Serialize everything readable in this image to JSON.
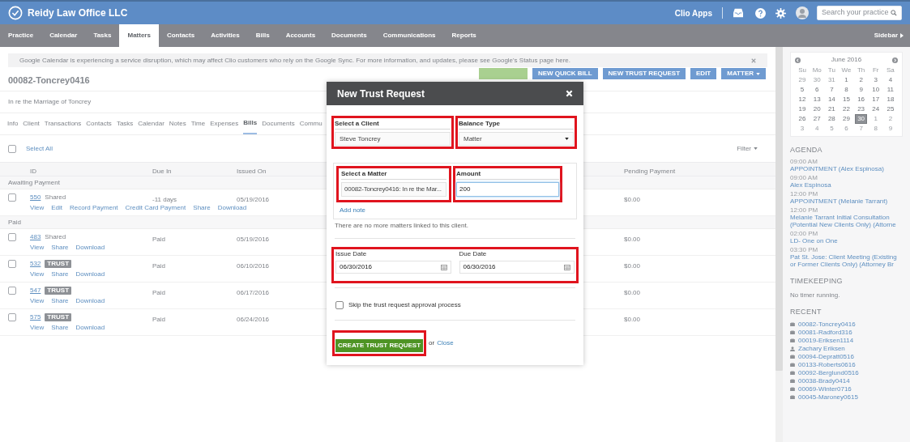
{
  "app_bar": {
    "title": "Reidy Law Office LLC",
    "apps_link": "Clio Apps",
    "search": {
      "placeholder": "Search your practice"
    }
  },
  "nav": {
    "tabs": [
      {
        "label": "Practice",
        "selected": false
      },
      {
        "label": "Calendar",
        "selected": false
      },
      {
        "label": "Tasks",
        "selected": false
      },
      {
        "label": "Matters",
        "selected": true
      },
      {
        "label": "Contacts",
        "selected": false
      },
      {
        "label": "Activities",
        "selected": false
      },
      {
        "label": "Bills",
        "selected": false
      },
      {
        "label": "Accounts",
        "selected": false
      },
      {
        "label": "Documents",
        "selected": false
      },
      {
        "label": "Communications",
        "selected": false
      },
      {
        "label": "Reports",
        "selected": false
      }
    ],
    "sidebar_toggle": "Sidebar"
  },
  "banner": {
    "text": "Google Calendar is experiencing a service disruption, which may affect Clio customers who rely on the Google Sync. For more information, and updates, please see Google's Status page here."
  },
  "matter": {
    "title": "00082-Toncrey0416",
    "description": "In re the Marriage of Toncrey",
    "actions": [
      {
        "kind": "success"
      },
      {
        "kind": "default",
        "label": "NEW QUICK BILL"
      },
      {
        "kind": "default",
        "label": "NEW TRUST REQUEST"
      },
      {
        "kind": "default",
        "label": "EDIT"
      },
      {
        "kind": "menu",
        "label": "MATTER"
      }
    ]
  },
  "tabs": [
    {
      "label": "Info",
      "selected": false
    },
    {
      "label": "Client",
      "selected": false
    },
    {
      "label": "Transactions",
      "selected": false
    },
    {
      "label": "Contacts",
      "selected": false
    },
    {
      "label": "Tasks",
      "selected": false
    },
    {
      "label": "Calendar",
      "selected": false
    },
    {
      "label": "Notes",
      "selected": false
    },
    {
      "label": "Time",
      "selected": false
    },
    {
      "label": "Expenses",
      "selected": false
    },
    {
      "label": "Bills",
      "selected": true
    },
    {
      "label": "Documents",
      "selected": false
    },
    {
      "label": "Commu",
      "selected": false
    }
  ],
  "bills": {
    "select_all": {
      "label": "Select All",
      "checked": false
    },
    "filter": "Filter",
    "columns": [
      "ID",
      "Due In",
      "Issued On",
      "Pending Payment"
    ],
    "groups": [
      {
        "name": "Awaiting Payment",
        "rows": [
          {
            "id": "550",
            "tag": {
              "kind": "shared",
              "text": "Shared"
            },
            "checked": false,
            "due_in": "-11 days",
            "issued_on": "05/19/2016",
            "pending_payment": "$0.00",
            "actions": [
              "View",
              "Edit",
              "Record Payment",
              "Credit Card Payment",
              "Share",
              "Download"
            ]
          }
        ]
      },
      {
        "name": "Paid",
        "rows": [
          {
            "id": "483",
            "tag": {
              "kind": "shared",
              "text": "Shared"
            },
            "checked": false,
            "due_in": "Paid",
            "issued_on": "05/19/2016",
            "pending_payment": "$0.00",
            "actions": [
              "View",
              "Share",
              "Download"
            ]
          },
          {
            "id": "532",
            "tag": {
              "kind": "badge",
              "text": "TRUST"
            },
            "checked": false,
            "due_in": "Paid",
            "issued_on": "06/10/2016",
            "pending_payment": "$0.00",
            "actions": [
              "View",
              "Share",
              "Download"
            ]
          },
          {
            "id": "547",
            "tag": {
              "kind": "badge",
              "text": "TRUST"
            },
            "checked": false,
            "due_in": "Paid",
            "issued_on": "06/17/2016",
            "pending_payment": "$0.00",
            "actions": [
              "View",
              "Share",
              "Download"
            ]
          },
          {
            "id": "575",
            "tag": {
              "kind": "badge",
              "text": "TRUST"
            },
            "checked": false,
            "due_in": "Paid",
            "issued_on": "06/24/2016",
            "pending_payment": "$0.00",
            "actions": [
              "View",
              "Share",
              "Download"
            ]
          }
        ]
      }
    ]
  },
  "modal": {
    "title": "New Trust Request",
    "client": {
      "label": "Select a Client",
      "value": "Steve Toncrey"
    },
    "balance_type": {
      "label": "Balance Type",
      "value": "Matter"
    },
    "matter": {
      "label": "Select a Matter",
      "value": "00082-Toncrey0416: In re the Mar..."
    },
    "amount": {
      "label": "Amount",
      "value": "200",
      "focused": true
    },
    "add_note": "Add note",
    "note": "There are no more matters linked to this client.",
    "issue_date": {
      "label": "Issue Date",
      "value": "06/30/2016"
    },
    "due_date": {
      "label": "Due Date",
      "value": "06/30/2016"
    },
    "skip_approval": {
      "label": "Skip the trust request approval process",
      "checked": false
    },
    "submit": "CREATE TRUST REQUEST",
    "close_prefix": "or",
    "close_link": "Close"
  },
  "sidebar": {
    "calendar": {
      "month": "June 2016",
      "weekdays": [
        "Su",
        "Mo",
        "Tu",
        "We",
        "Th",
        "Fr",
        "Sa"
      ],
      "weeks": [
        [
          {
            "d": "29",
            "other_month": true,
            "selected": false
          },
          {
            "d": "30",
            "other_month": true,
            "selected": false
          },
          {
            "d": "31",
            "other_month": true,
            "selected": false
          },
          {
            "d": "1",
            "other_month": false,
            "selected": false
          },
          {
            "d": "2",
            "other_month": false,
            "selected": false
          },
          {
            "d": "3",
            "other_month": false,
            "selected": false
          },
          {
            "d": "4",
            "other_month": false,
            "selected": false
          }
        ],
        [
          {
            "d": "5",
            "other_month": false,
            "selected": false
          },
          {
            "d": "6",
            "other_month": false,
            "selected": false
          },
          {
            "d": "7",
            "other_month": false,
            "selected": false
          },
          {
            "d": "8",
            "other_month": false,
            "selected": false
          },
          {
            "d": "9",
            "other_month": false,
            "selected": false
          },
          {
            "d": "10",
            "other_month": false,
            "selected": false
          },
          {
            "d": "11",
            "other_month": false,
            "selected": false
          }
        ],
        [
          {
            "d": "12",
            "other_month": false,
            "selected": false
          },
          {
            "d": "13",
            "other_month": false,
            "selected": false
          },
          {
            "d": "14",
            "other_month": false,
            "selected": false
          },
          {
            "d": "15",
            "other_month": false,
            "selected": false
          },
          {
            "d": "16",
            "other_month": false,
            "selected": false
          },
          {
            "d": "17",
            "other_month": false,
            "selected": false
          },
          {
            "d": "18",
            "other_month": false,
            "selected": false
          }
        ],
        [
          {
            "d": "19",
            "other_month": false,
            "selected": false
          },
          {
            "d": "20",
            "other_month": false,
            "selected": false
          },
          {
            "d": "21",
            "other_month": false,
            "selected": false
          },
          {
            "d": "22",
            "other_month": false,
            "selected": false
          },
          {
            "d": "23",
            "other_month": false,
            "selected": false
          },
          {
            "d": "24",
            "other_month": false,
            "selected": false
          },
          {
            "d": "25",
            "other_month": false,
            "selected": false
          }
        ],
        [
          {
            "d": "26",
            "other_month": false,
            "selected": false
          },
          {
            "d": "27",
            "other_month": false,
            "selected": false
          },
          {
            "d": "28",
            "other_month": false,
            "selected": false
          },
          {
            "d": "29",
            "other_month": false,
            "selected": false
          },
          {
            "d": "30",
            "other_month": false,
            "selected": true
          },
          {
            "d": "1",
            "other_month": true,
            "selected": false
          },
          {
            "d": "2",
            "other_month": true,
            "selected": false
          }
        ],
        [
          {
            "d": "3",
            "other_month": true,
            "selected": false
          },
          {
            "d": "4",
            "other_month": true,
            "selected": false
          },
          {
            "d": "5",
            "other_month": true,
            "selected": false
          },
          {
            "d": "6",
            "other_month": true,
            "selected": false
          },
          {
            "d": "7",
            "other_month": true,
            "selected": false
          },
          {
            "d": "8",
            "other_month": true,
            "selected": false
          },
          {
            "d": "9",
            "other_month": true,
            "selected": false
          }
        ]
      ]
    },
    "agenda": {
      "title": "AGENDA",
      "items": [
        {
          "time": "09:00 AM",
          "title": "APPOINTMENT (Alex Espinosa)"
        },
        {
          "time": "09:00 AM",
          "title": "Alex Espinosa"
        },
        {
          "time": "12:00 PM",
          "title": "APPOINTMENT (Melanie Tarrant)"
        },
        {
          "time": "12:00 PM",
          "title": "Melanie Tarrant Initial Consultation (Potential New Clients Only) (Attorne"
        },
        {
          "time": "02:00 PM",
          "title": "LD- One on One"
        },
        {
          "time": "03:30 PM",
          "title": "Pat St. Jose: Client Meeting (Existing or Former Clients Only) (Attorney Br"
        }
      ]
    },
    "timekeeping": {
      "title": "TIMEKEEPING",
      "status": "No timer running."
    },
    "recent": {
      "title": "RECENT",
      "items": [
        {
          "kind": "matter",
          "label": "00082-Toncrey0416"
        },
        {
          "kind": "matter",
          "label": "00081-Radford316"
        },
        {
          "kind": "matter",
          "label": "00019-Eriksen1114"
        },
        {
          "kind": "contact",
          "label": "Zachary Eriksen"
        },
        {
          "kind": "matter",
          "label": "00094-Depratt0516"
        },
        {
          "kind": "matter",
          "label": "00133-Roberts0616"
        },
        {
          "kind": "matter",
          "label": "00092-Berglund0516"
        },
        {
          "kind": "matter",
          "label": "00038-Brady0414"
        },
        {
          "kind": "matter",
          "label": "00069-Winter0716"
        },
        {
          "kind": "matter",
          "label": "00045-Maroney0615"
        }
      ]
    }
  }
}
